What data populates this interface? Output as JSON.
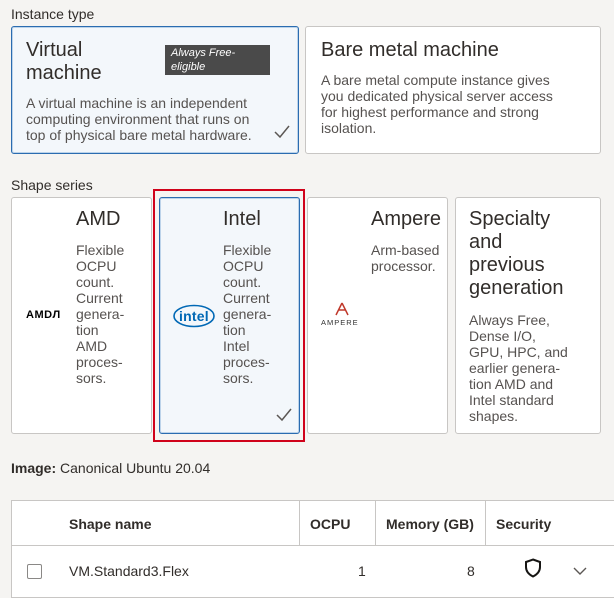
{
  "instance_type": {
    "label": "Instance type",
    "virtual": {
      "title_line1": "Virtual",
      "title_line2": "machine",
      "badge_line1": "Always Free-",
      "badge_line2": "eligible",
      "desc": [
        "A virtual machine is an independent",
        "computing environment that runs on",
        "top of physical bare metal hardware."
      ],
      "selected": true
    },
    "bare_metal": {
      "title": "Bare metal machine",
      "desc": [
        "A bare metal compute instance gives",
        "you dedicated physical server access",
        "for highest performance and strong",
        "isolation."
      ],
      "selected": false
    }
  },
  "shape_series": {
    "label": "Shape series",
    "cards": [
      {
        "title": [
          "AMD"
        ],
        "desc": [
          "Flexible",
          "OCPU",
          "count.",
          "Current",
          "genera-",
          "tion",
          "AMD",
          "proces-",
          "sors."
        ],
        "logo": "AMDЛ",
        "logo_name": "amd-logo",
        "selected": false
      },
      {
        "title": [
          "Intel"
        ],
        "desc": [
          "Flexible",
          "OCPU",
          "count.",
          "Current",
          "genera-",
          "tion",
          "Intel",
          "proces-",
          "sors."
        ],
        "logo": "intel",
        "logo_name": "intel-logo",
        "selected": true
      },
      {
        "title": [
          "Ampere"
        ],
        "desc": [
          "Arm-based",
          "processor."
        ],
        "logo": "AMPERE",
        "logo_name": "ampere-logo",
        "selected": false
      },
      {
        "title": [
          "Specialty",
          "and",
          "previous",
          "generation"
        ],
        "desc": [
          "Always Free,",
          "Dense I/O,",
          "GPU, HPC, and",
          "earlier genera-",
          "tion AMD and",
          "Intel standard",
          "shapes."
        ],
        "selected": false
      }
    ]
  },
  "image": {
    "label": "Image:",
    "value": "Canonical Ubuntu 20.04"
  },
  "table": {
    "headers": [
      "Shape name",
      "OCPU",
      "Memory (GB)",
      "Security"
    ],
    "rows": [
      {
        "name": "VM.Standard3.Flex",
        "ocpu": "1",
        "memory": "8",
        "security_icon": "shield-icon",
        "checked": false
      }
    ]
  },
  "colors": {
    "selected_border": "#2b6cb0",
    "highlight": "#d0021b",
    "intel_blue": "#0068b5",
    "ampere_red": "#c0392b"
  }
}
